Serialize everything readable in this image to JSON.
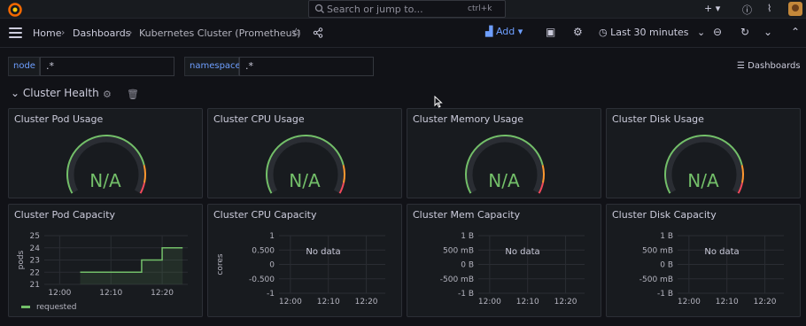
{
  "topbar": {
    "search_placeholder": "Search or jump to...",
    "search_shortcut": "ctrl+k",
    "new_label": "+"
  },
  "navbar": {
    "breadcrumb": [
      "Home",
      "Dashboards",
      "Kubernetes Cluster (Prometheus)"
    ],
    "add_label": "Add",
    "time_range": "Last 30 minutes"
  },
  "variables": [
    {
      "label": "node",
      "value": ".*"
    },
    {
      "label": "namespace",
      "value": ".*"
    }
  ],
  "dashboards_link": "Dashboards",
  "row": {
    "title": "Cluster Health"
  },
  "gauges": [
    {
      "title": "Cluster Pod Usage",
      "value": "N/A"
    },
    {
      "title": "Cluster CPU Usage",
      "value": "N/A"
    },
    {
      "title": "Cluster Memory Usage",
      "value": "N/A"
    },
    {
      "title": "Cluster Disk Usage",
      "value": "N/A"
    }
  ],
  "colors": {
    "green": "#73bf69",
    "orange": "#ff9830",
    "red": "#f2495c",
    "blue": "#6e9fff"
  },
  "chart_data": [
    {
      "type": "line",
      "title": "Cluster Pod Capacity",
      "ylabel": "pods",
      "yticks": [
        "25",
        "24",
        "23",
        "22",
        "21"
      ],
      "xticks": [
        "12:00",
        "12:10",
        "12:20"
      ],
      "ylim": [
        21,
        25
      ],
      "series": [
        {
          "name": "requested",
          "x": [
            "12:04",
            "12:16",
            "12:16",
            "12:20",
            "12:20",
            "12:24"
          ],
          "values": [
            22,
            22,
            23,
            23,
            24,
            24
          ]
        }
      ],
      "legend": "bottom-left"
    },
    {
      "type": "line",
      "title": "Cluster CPU Capacity",
      "ylabel": "cores",
      "yticks": [
        "1",
        "0.500",
        "0",
        "-0.500",
        "-1"
      ],
      "xticks": [
        "12:00",
        "12:10",
        "12:20"
      ],
      "no_data": "No data"
    },
    {
      "type": "line",
      "title": "Cluster Mem Capacity",
      "ylabel": "",
      "yticks": [
        "1 B",
        "500 mB",
        "0 B",
        "-500 mB",
        "-1 B"
      ],
      "xticks": [
        "12:00",
        "12:10",
        "12:20"
      ],
      "no_data": "No data"
    },
    {
      "type": "line",
      "title": "Cluster Disk Capacity",
      "ylabel": "",
      "yticks": [
        "1 B",
        "500 mB",
        "0 B",
        "-500 mB",
        "-1 B"
      ],
      "xticks": [
        "12:00",
        "12:10",
        "12:20"
      ],
      "no_data": "No data"
    }
  ]
}
